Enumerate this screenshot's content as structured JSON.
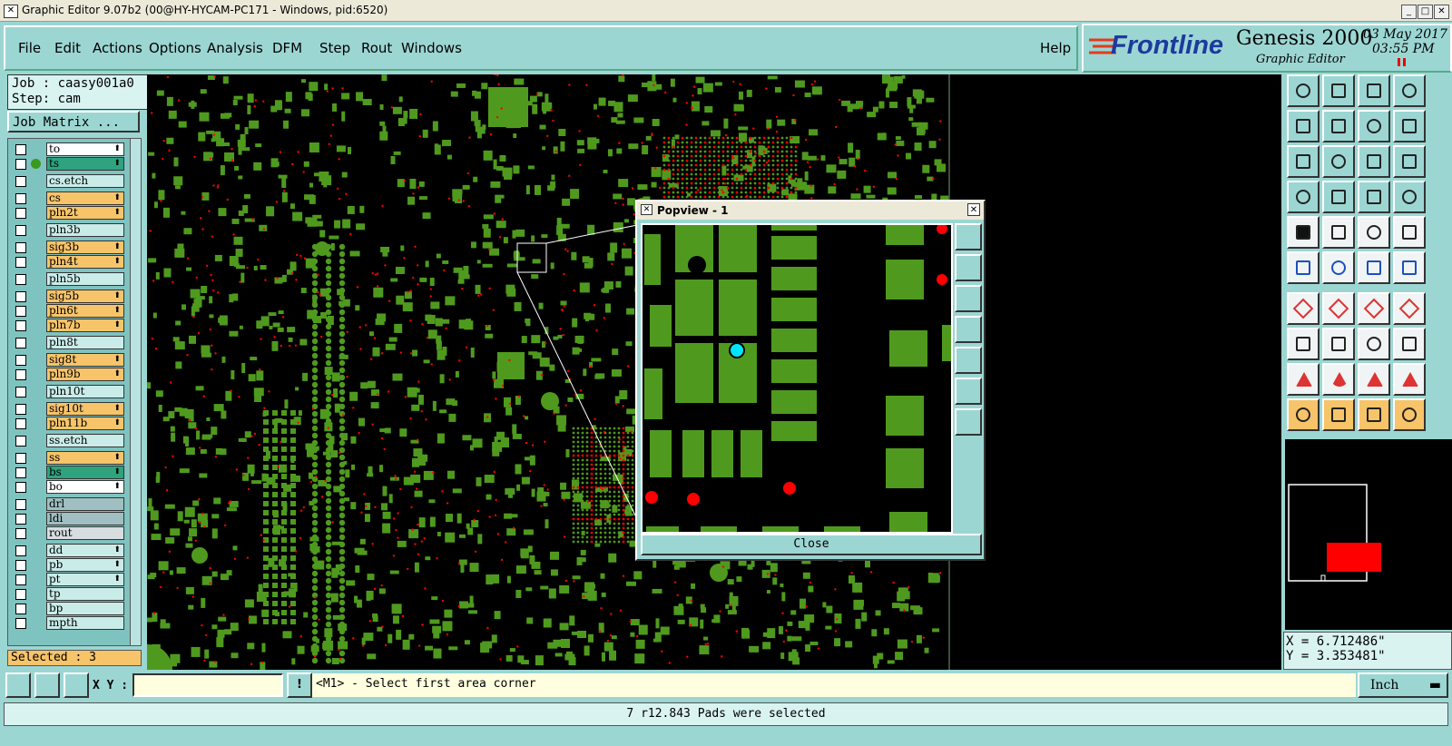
{
  "window": {
    "title": "Graphic Editor 9.07b2 (00@HY-HYCAM-PC171 - Windows, pid:6520)"
  },
  "menu": {
    "items": [
      "File",
      "Edit",
      "Actions",
      "Options",
      "Analysis",
      "DFM",
      "Step",
      "Rout",
      "Windows"
    ],
    "help": "Help"
  },
  "branding": {
    "logo": "Frontline",
    "product": "Genesis 2000",
    "subtitle": "Graphic Editor",
    "date": "03 May 2017",
    "time": "03:55 PM"
  },
  "job": {
    "job_line": "Job : caasy001a0",
    "step_line": "Step: cam",
    "matrix_button": "Job Matrix ..."
  },
  "layers": [
    {
      "name": "to",
      "color": "#ffffff",
      "arrow": true
    },
    {
      "name": "ts",
      "color": "#2fa27e",
      "arrow": true
    },
    {
      "name": "cs.etch",
      "color": "#c9ece9",
      "arrow": false
    },
    {
      "name": "cs",
      "color": "#f7c46a",
      "arrow": true
    },
    {
      "name": "pln2t",
      "color": "#f7c46a",
      "arrow": true
    },
    {
      "name": "pln3b",
      "color": "#c9ece9",
      "arrow": false
    },
    {
      "name": "sig3b",
      "color": "#f7c46a",
      "arrow": true
    },
    {
      "name": "pln4t",
      "color": "#f7c46a",
      "arrow": true
    },
    {
      "name": "pln5b",
      "color": "#c9ece9",
      "arrow": false
    },
    {
      "name": "sig5b",
      "color": "#f7c46a",
      "arrow": true
    },
    {
      "name": "pln6t",
      "color": "#f7c46a",
      "arrow": true
    },
    {
      "name": "pln7b",
      "color": "#f7c46a",
      "arrow": true
    },
    {
      "name": "pln8t",
      "color": "#c9ece9",
      "arrow": false
    },
    {
      "name": "sig8t",
      "color": "#f7c46a",
      "arrow": true
    },
    {
      "name": "pln9b",
      "color": "#f7c46a",
      "arrow": true
    },
    {
      "name": "pln10t",
      "color": "#c9ece9",
      "arrow": false
    },
    {
      "name": "sig10t",
      "color": "#f7c46a",
      "arrow": true
    },
    {
      "name": "pln11b",
      "color": "#f7c46a",
      "arrow": true
    },
    {
      "name": "ss.etch",
      "color": "#c9ece9",
      "arrow": false
    },
    {
      "name": "ss",
      "color": "#f7c46a",
      "arrow": true
    },
    {
      "name": "bs",
      "color": "#2fa27e",
      "arrow": true
    },
    {
      "name": "bo",
      "color": "#ffffff",
      "arrow": true
    },
    {
      "name": "drl",
      "color": "#9fbfc2",
      "arrow": false
    },
    {
      "name": "ldi",
      "color": "#9fbfc2",
      "arrow": false
    },
    {
      "name": "rout",
      "color": "#d8dde0",
      "arrow": false
    },
    {
      "name": "dd",
      "color": "#c9ece9",
      "arrow": true
    },
    {
      "name": "pb",
      "color": "#c9ece9",
      "arrow": true
    },
    {
      "name": "pt",
      "color": "#c9ece9",
      "arrow": true
    },
    {
      "name": "tp",
      "color": "#c9ece9",
      "arrow": false
    },
    {
      "name": "bp",
      "color": "#c9ece9",
      "arrow": false
    },
    {
      "name": "mpth",
      "color": "#c9ece9",
      "arrow": false
    }
  ],
  "selected": "Selected : 3",
  "xy": {
    "label": "X Y :",
    "value": ""
  },
  "prompt": "<M1> - Select first area corner",
  "units": "Inch",
  "status": "7 r12.843 Pads were selected",
  "coords": {
    "x": "X = 6.712486\"",
    "y": "Y = 3.353481\""
  },
  "popview": {
    "title": "Popview - 1",
    "close_label": "Close"
  },
  "colors": {
    "panel": "#9cd6d3",
    "pad": "#4f9a1e",
    "drill": "#ff0000",
    "highlight": "#00e5ff"
  }
}
